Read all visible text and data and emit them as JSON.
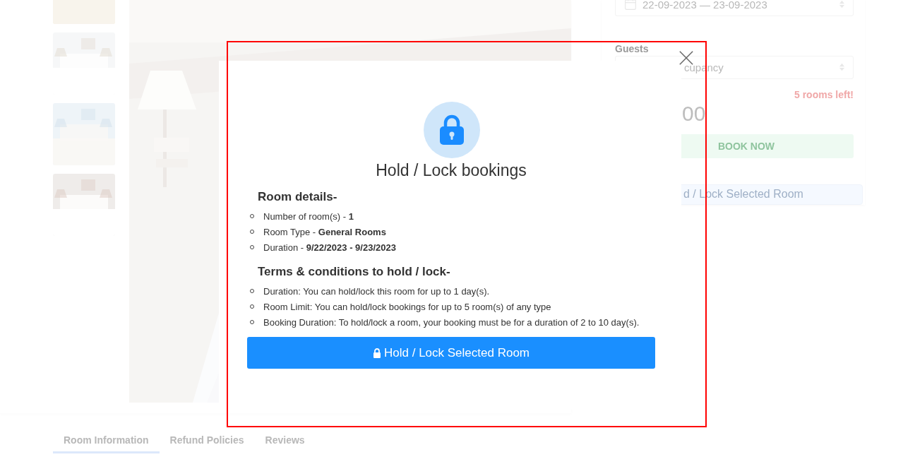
{
  "booking_panel": {
    "date_range": "22-09-2023 — 23-09-2023",
    "guests_label": "Guests",
    "guests_value": "cupancy",
    "availability": "5 rooms left!",
    "price": "00",
    "book_button": "BOOK NOW",
    "hold_button": "d / Lock Selected Room"
  },
  "tabs": [
    {
      "label": "Room Information",
      "selected": true
    },
    {
      "label": "Refund Policies",
      "selected": false
    },
    {
      "label": "Reviews",
      "selected": false
    }
  ],
  "modal": {
    "title": "Hold / Lock bookings",
    "sections": [
      {
        "heading": "Room details-",
        "items": [
          "Number of room(s) - **1**",
          "Room Type - **General Rooms**",
          "Duration - **9/22/2023 - 9/23/2023**"
        ]
      },
      {
        "heading": "Terms & conditions to hold / lock-",
        "items": [
          "Duration: You can hold/lock this room for up to 1 day(s).",
          "Room Limit: You can hold/lock bookings for up to 5 room(s) of any type",
          "Booking Duration: To hold/lock a room, your booking must be for a duration of 2 to 10 day(s)."
        ]
      }
    ],
    "button": "Hold / Lock Selected Room"
  }
}
